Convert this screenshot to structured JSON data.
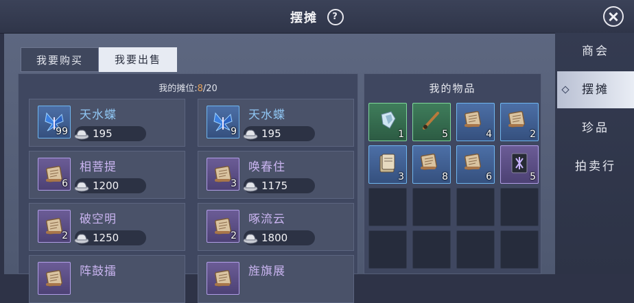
{
  "header": {
    "title": "摆摊",
    "help_icon": "?",
    "close_icon": "close-icon"
  },
  "tabs": [
    {
      "label": "我要购买",
      "active": false
    },
    {
      "label": "我要出售",
      "active": true
    }
  ],
  "slots": {
    "label": "我的摊位:",
    "used": "8",
    "total": "/20"
  },
  "listings": [
    {
      "name": "天水蝶",
      "count": "99",
      "price": "195",
      "rarity": "blue",
      "icon": "butterfly-icon"
    },
    {
      "name": "天水蝶",
      "count": "9",
      "price": "195",
      "rarity": "blue",
      "icon": "butterfly-icon"
    },
    {
      "name": "相菩提",
      "count": "6",
      "price": "1200",
      "rarity": "purple",
      "icon": "scroll-icon"
    },
    {
      "name": "唤春住",
      "count": "3",
      "price": "1175",
      "rarity": "purple",
      "icon": "scroll-icon"
    },
    {
      "name": "破空明",
      "count": "2",
      "price": "1250",
      "rarity": "purple",
      "icon": "scroll-icon"
    },
    {
      "name": "啄流云",
      "count": "2",
      "price": "1800",
      "rarity": "purple",
      "icon": "scroll-icon"
    },
    {
      "name": "阵鼓擂",
      "count": "",
      "price": "",
      "rarity": "purple",
      "icon": "scroll-icon"
    },
    {
      "name": "旌旗展",
      "count": "",
      "price": "",
      "rarity": "purple",
      "icon": "scroll-icon"
    }
  ],
  "inventory": {
    "title": "我的物品",
    "items": [
      {
        "count": "1",
        "rarity": "green",
        "icon": "crystal-icon"
      },
      {
        "count": "5",
        "rarity": "green",
        "icon": "brush-icon"
      },
      {
        "count": "4",
        "rarity": "blue",
        "icon": "scroll-icon"
      },
      {
        "count": "2",
        "rarity": "blue",
        "icon": "scroll-icon"
      },
      {
        "count": "3",
        "rarity": "blue",
        "icon": "book-icon"
      },
      {
        "count": "8",
        "rarity": "blue",
        "icon": "scroll-icon"
      },
      {
        "count": "6",
        "rarity": "blue",
        "icon": "scroll-icon"
      },
      {
        "count": "5",
        "rarity": "purple",
        "icon": "rune-icon"
      }
    ],
    "empty_slots": 8
  },
  "sidenav": [
    {
      "label": "商会",
      "active": false
    },
    {
      "label": "摆摊",
      "active": true
    },
    {
      "label": "珍品",
      "active": false
    },
    {
      "label": "拍卖行",
      "active": false
    }
  ],
  "colors": {
    "accent_orange": "#e4a15a",
    "name_blue": "#8fc5f2",
    "name_purple": "#c9b4f0",
    "rarity_green": "#7fd89a",
    "rarity_blue": "#6fb6f0",
    "rarity_purple": "#b29ee8"
  }
}
